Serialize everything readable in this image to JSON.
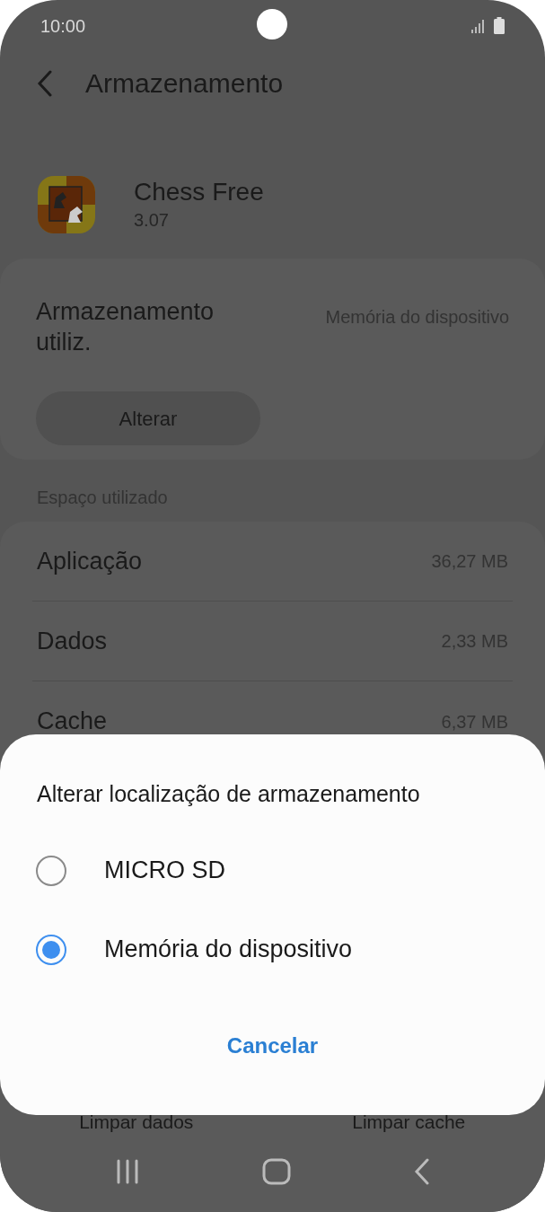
{
  "status_bar": {
    "time": "10:00"
  },
  "header": {
    "title": "Armazenamento"
  },
  "app": {
    "name": "Chess Free",
    "version": "3.07"
  },
  "storage_location": {
    "label": "Armazenamento utiliz.",
    "value": "Memória do dispositivo",
    "button": "Alterar"
  },
  "section_title": "Espaço utilizado",
  "usage_rows": [
    {
      "label": "Aplicação",
      "value": "36,27 MB"
    },
    {
      "label": "Dados",
      "value": "2,33 MB"
    },
    {
      "label": "Cache",
      "value": "6,37 MB"
    }
  ],
  "actions": [
    "Limpar dados",
    "Limpar cache"
  ],
  "dialog": {
    "title": "Alterar localização de armazenamento",
    "options": [
      {
        "label": "MICRO SD",
        "selected": false
      },
      {
        "label": "Memória do dispositivo",
        "selected": true
      }
    ],
    "cancel": "Cancelar"
  }
}
